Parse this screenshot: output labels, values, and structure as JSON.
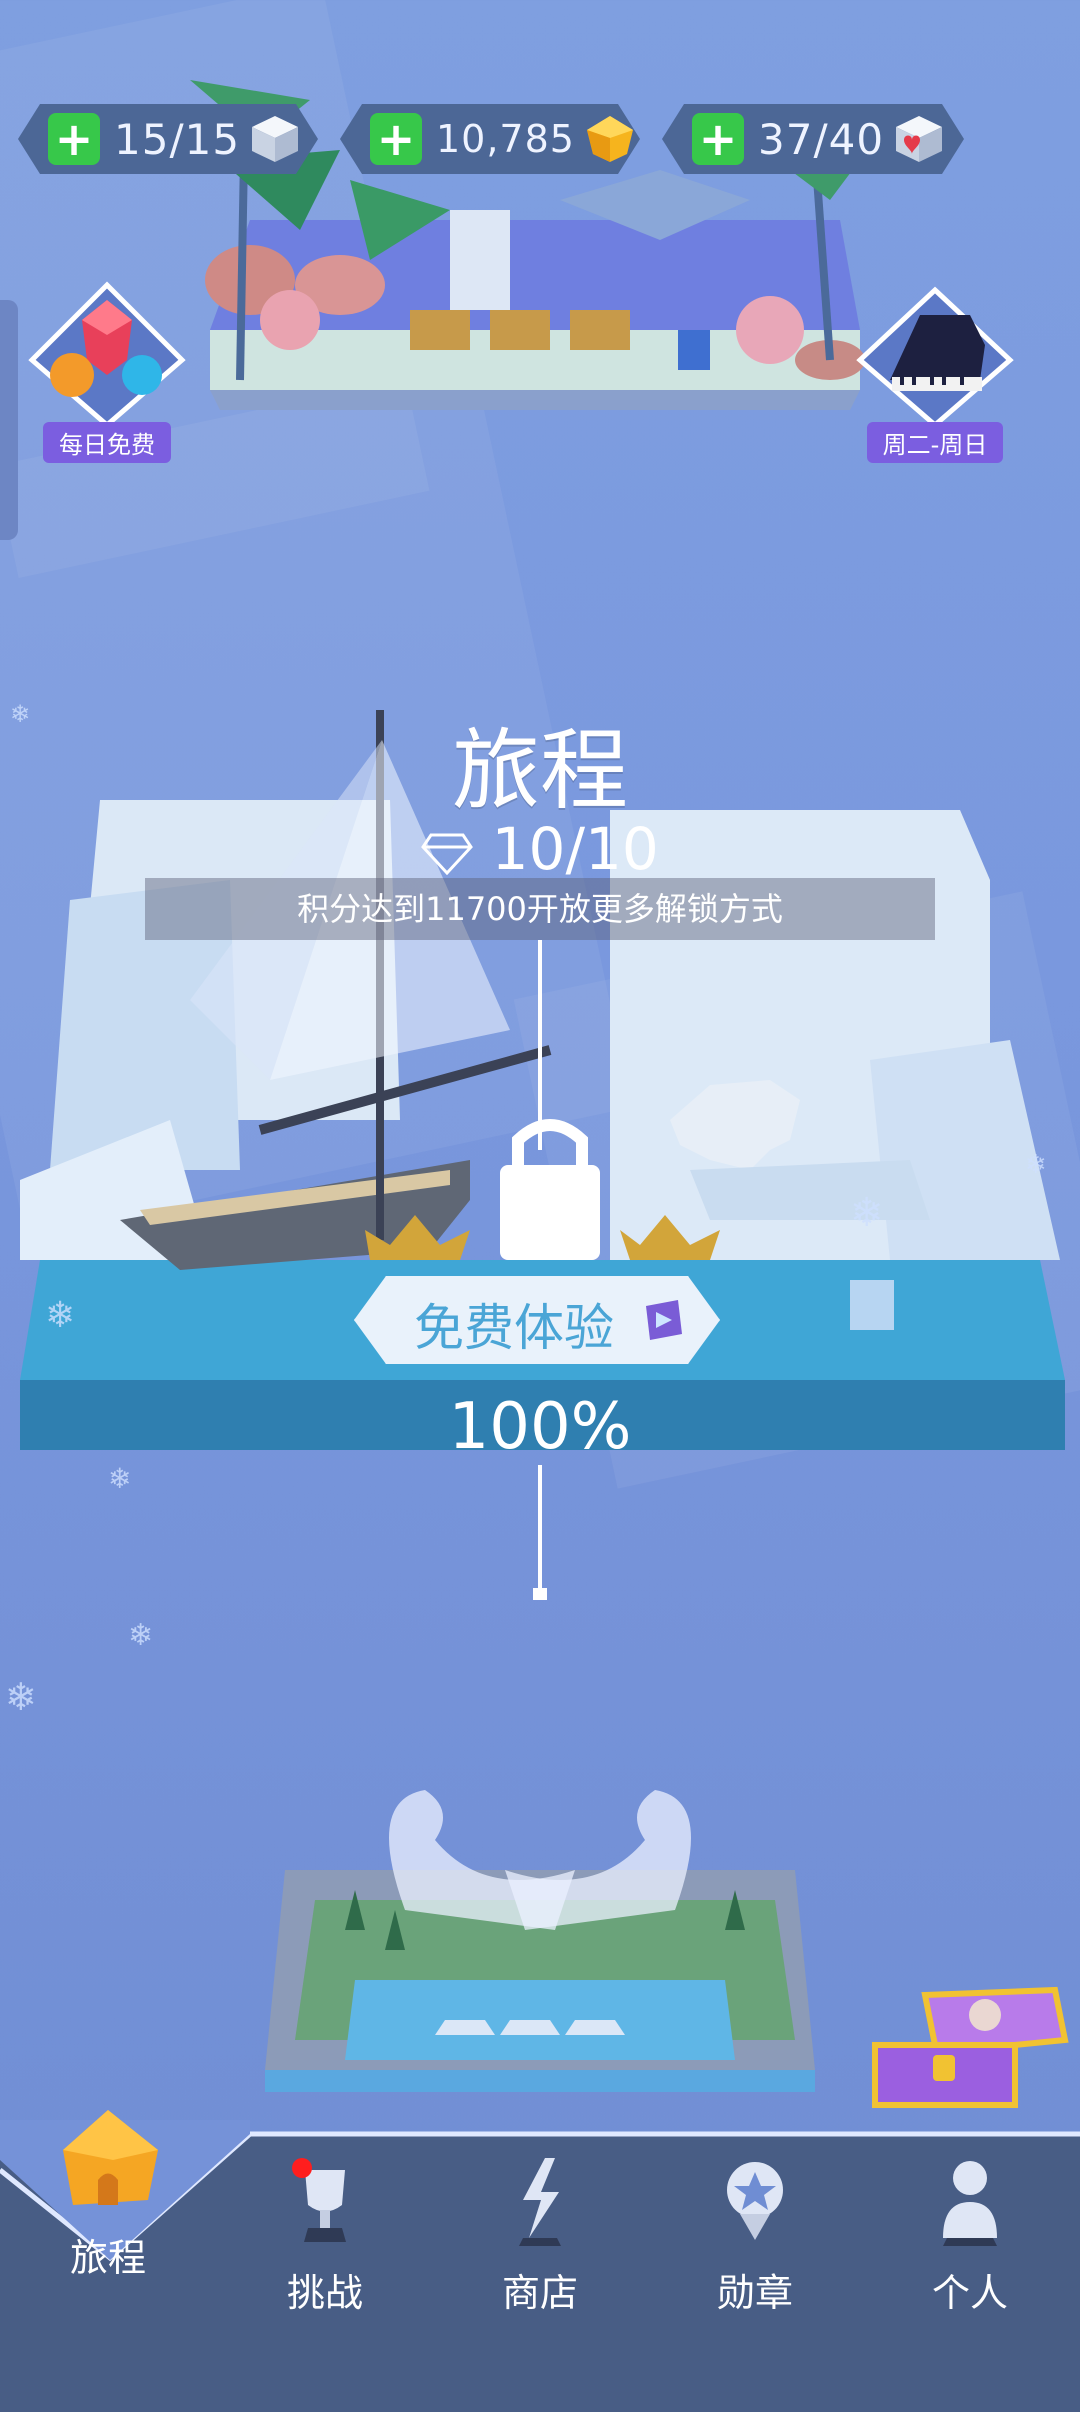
{
  "top_bar": {
    "lives": {
      "value": "15/15",
      "icon": "cube-icon"
    },
    "diamonds": {
      "value": "10,785",
      "icon": "gold-gem-icon"
    },
    "hearts": {
      "value": "37/40",
      "icon": "heart-cube-icon"
    },
    "plus_symbol": "+"
  },
  "side": {
    "daily_free": "每日免费",
    "weekly": "周二-周日"
  },
  "level": {
    "title": "旅程",
    "gems": "10/10",
    "unlock_notice": "积分达到11700开放更多解锁方式",
    "free_trial": "免费体验",
    "progress": "100%"
  },
  "nav": {
    "items": [
      {
        "label": "旅程",
        "icon": "house-icon"
      },
      {
        "label": "挑战",
        "icon": "trophy-icon"
      },
      {
        "label": "商店",
        "icon": "lightning-icon"
      },
      {
        "label": "勋章",
        "icon": "medal-icon"
      },
      {
        "label": "个人",
        "icon": "person-icon"
      }
    ]
  },
  "colors": {
    "background": "#7a98de",
    "nav_bar": "#485d85",
    "plus_green": "#37c84a",
    "water": "#3fa6d6",
    "accent_purple": "#7b5ee0"
  }
}
